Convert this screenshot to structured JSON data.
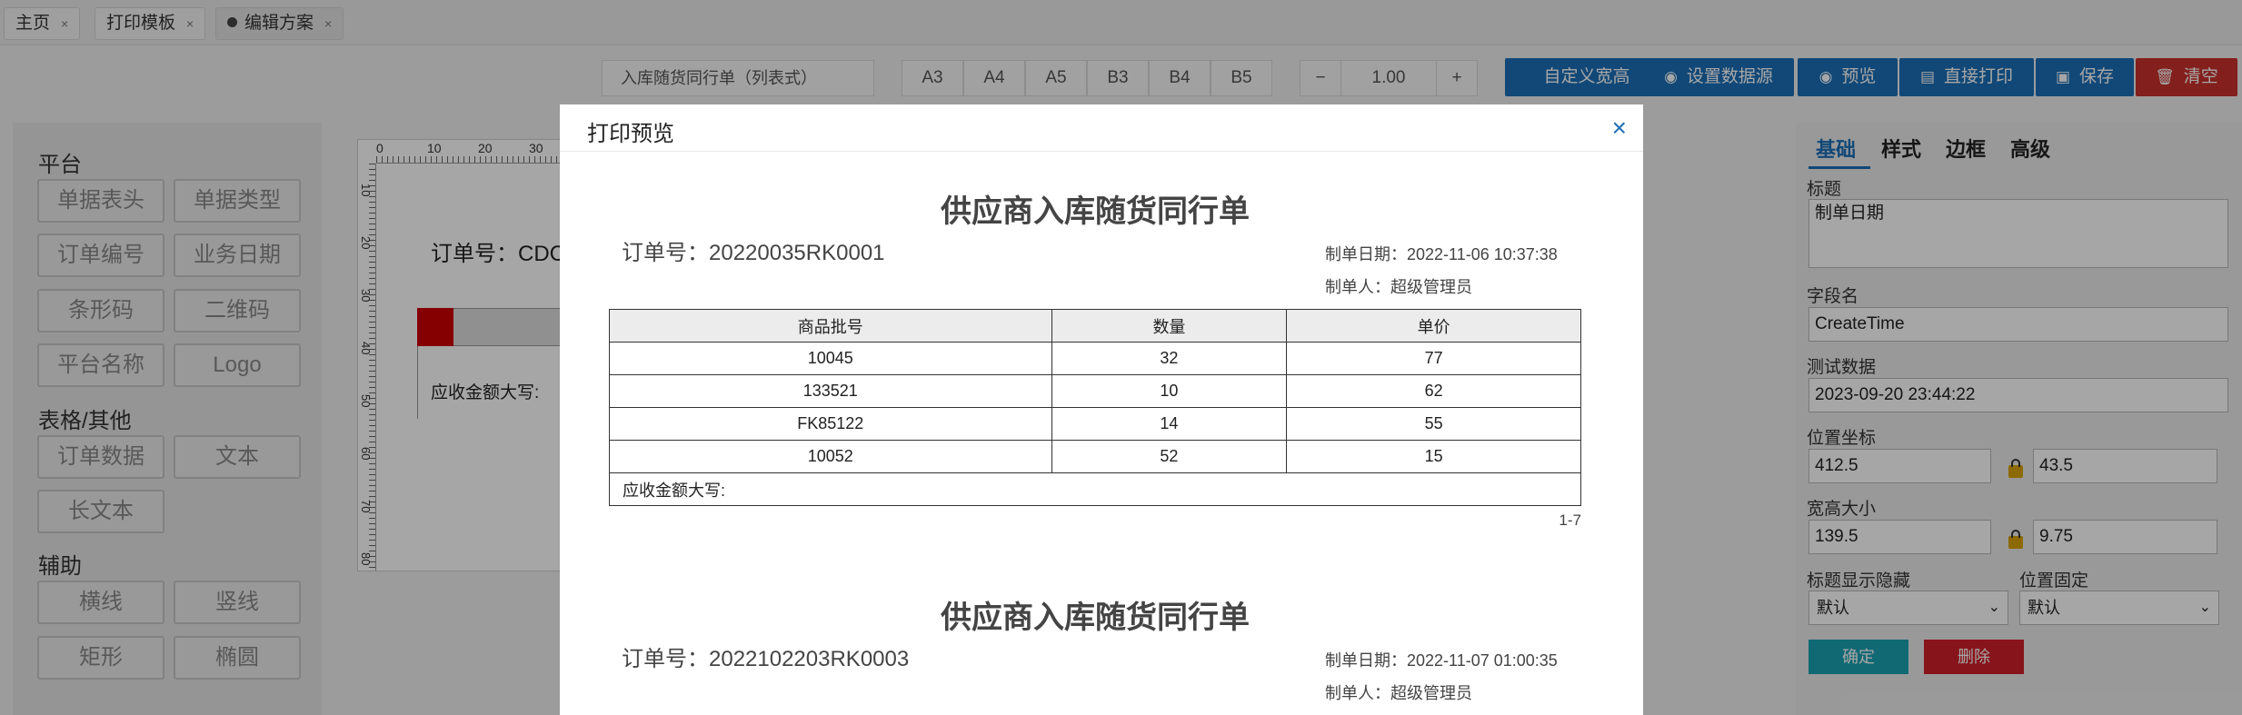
{
  "tabs": [
    {
      "label": "主页",
      "close": "×"
    },
    {
      "label": "打印模板",
      "close": "×"
    },
    {
      "label": "编辑方案",
      "close": "×"
    }
  ],
  "toolbar": {
    "template_name": "入库随货同行单（列表式）",
    "paper_sizes": [
      "A3",
      "A4",
      "A5",
      "B3",
      "B4",
      "B5"
    ],
    "zoom_minus": "−",
    "zoom_value": "1.00",
    "zoom_plus": "+",
    "custom_size": "自定义宽高",
    "set_datasource": "设置数据源",
    "preview": "预览",
    "direct_print": "直接打印",
    "save": "保存",
    "clear": "清空"
  },
  "left_panel": {
    "section_platform": "平台",
    "platform_items": [
      "单据表头",
      "单据类型",
      "订单编号",
      "业务日期",
      "条形码",
      "二维码",
      "平台名称",
      "Logo"
    ],
    "section_table": "表格/其他",
    "table_items": [
      "订单数据",
      "文本",
      "长文本"
    ],
    "section_aux": "辅助",
    "aux_items": [
      "横线",
      "竖线",
      "矩形",
      "椭圆"
    ]
  },
  "canvas": {
    "ruler_h": [
      "0",
      "10",
      "20",
      "30"
    ],
    "ruler_v": [
      "10",
      "20",
      "30",
      "40",
      "50",
      "60",
      "70",
      "80"
    ],
    "order_label": "订单号：CDC",
    "amount_label": "应收金额大写:"
  },
  "modal": {
    "title": "打印预览",
    "close": "×",
    "documents": [
      {
        "title": "供应商入库随货同行单",
        "order": "订单号：20220035RK0001",
        "date": "制单日期：2022-11-06 10:37:38",
        "maker": "制单人：超级管理员",
        "headers": [
          "商品批号",
          "数量",
          "单价"
        ],
        "rows": [
          [
            "10045",
            "32",
            "77"
          ],
          [
            "133521",
            "10",
            "62"
          ],
          [
            "FK85122",
            "14",
            "55"
          ],
          [
            "10052",
            "52",
            "15"
          ]
        ],
        "amount": "应收金额大写:",
        "page": "1-7"
      },
      {
        "title": "供应商入库随货同行单",
        "order": "订单号：2022102203RK0003",
        "date": "制单日期：2022-11-07 01:00:35",
        "maker": "制单人：超级管理员"
      }
    ]
  },
  "right_panel": {
    "tabs": [
      "基础",
      "样式",
      "边框",
      "高级"
    ],
    "title_label": "标题",
    "title_value": "制单日期",
    "field_label": "字段名",
    "field_value": "CreateTime",
    "test_label": "测试数据",
    "test_value": "2023-09-20 23:44:22",
    "pos_label": "位置坐标",
    "pos_x": "412.5",
    "pos_y": "43.5",
    "size_label": "宽高大小",
    "width": "139.5",
    "height": "9.75",
    "title_visible_label": "标题显示隐藏",
    "title_visible_value": "默认",
    "pos_fixed_label": "位置固定",
    "pos_fixed_value": "默认",
    "confirm": "确定",
    "delete": "删除"
  },
  "colors": {
    "primary": "#1b6fb7",
    "danger": "#c9302c",
    "teal": "#1ba1b3",
    "red": "#d0202a"
  }
}
